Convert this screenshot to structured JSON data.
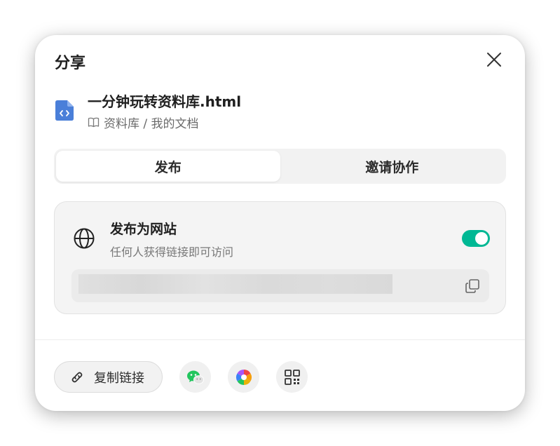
{
  "dialog": {
    "title": "分享",
    "file": {
      "name": "一分钟玩转资料库.html",
      "path": "资料库 / 我的文档"
    },
    "tabs": [
      {
        "label": "发布",
        "active": true
      },
      {
        "label": "邀请协作",
        "active": false
      }
    ],
    "publish": {
      "title": "发布为网站",
      "subtitle": "任何人获得链接即可访问",
      "toggle_on": true,
      "toggle_color": "#00b894"
    },
    "footer": {
      "copy_link_label": "复制链接",
      "share_icons": [
        "wechat-icon",
        "color-wheel-icon",
        "qrcode-icon"
      ]
    }
  }
}
